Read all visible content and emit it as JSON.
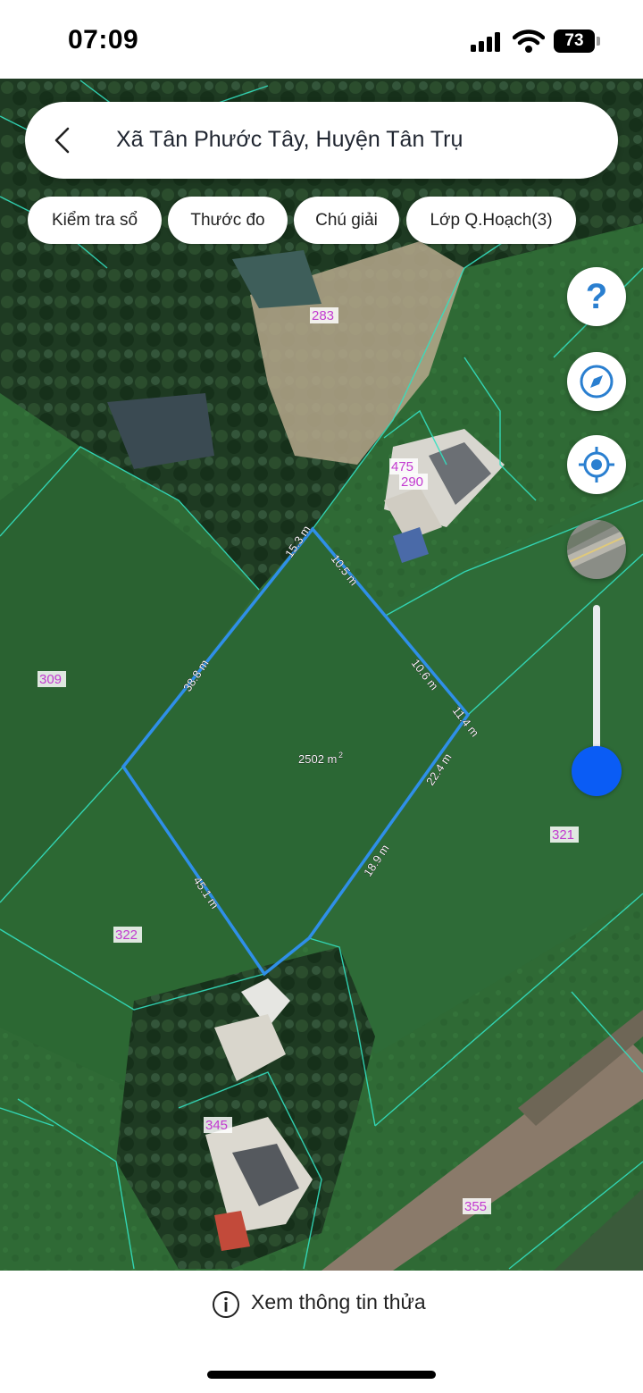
{
  "status_bar": {
    "time": "07:09",
    "battery": "73"
  },
  "search": {
    "title": "Xã Tân Phước Tây, Huyện Tân Trụ"
  },
  "chips": [
    {
      "label": "Kiểm tra sổ"
    },
    {
      "label": "Thước đo"
    },
    {
      "label": "Chú giải"
    },
    {
      "label": "Lớp Q.Hoạch(3)"
    }
  ],
  "map_controls": {
    "help": "?",
    "compass": "compass-icon",
    "locate": "locate-icon",
    "layer": "satellite-layer-thumbnail"
  },
  "zoom_level": 0.95,
  "parcel_numbers": [
    "283",
    "475",
    "290",
    "309",
    "321",
    "322",
    "345",
    "355"
  ],
  "parcel": {
    "area_value": "2502 m",
    "area_sup": "2",
    "edges": [
      "15.3 m",
      "10.5 m",
      "10.6 m",
      "11.4 m",
      "22.4 m",
      "18.9 m",
      "45.1 m",
      "38.8 m"
    ]
  },
  "bottom": {
    "info_label": "Xem thông tin thửa"
  },
  "colors": {
    "parcel_outline": "#2f8fe8",
    "boundary": "#33e0c0",
    "parcel_label": "#c23ad0",
    "zoom_knob": "#0a5cf5"
  }
}
